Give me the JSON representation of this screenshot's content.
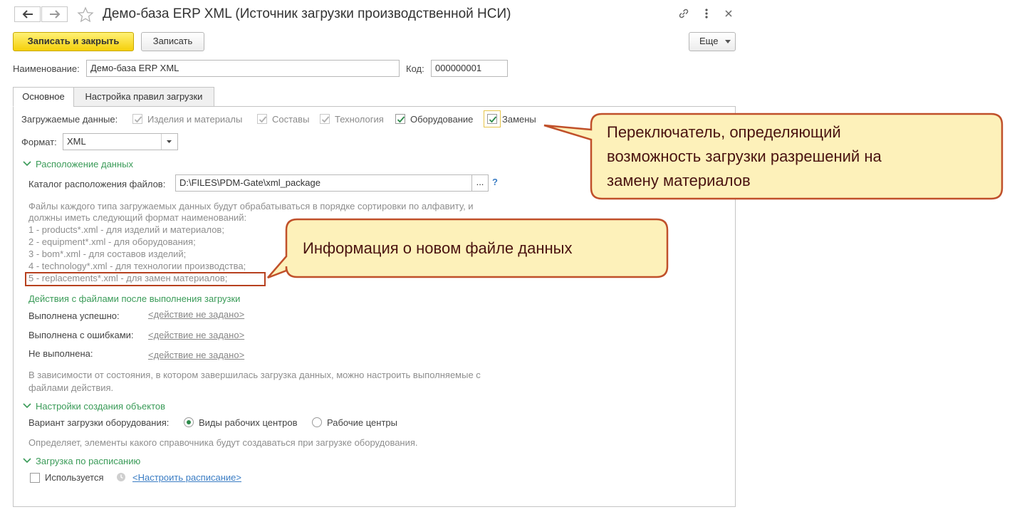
{
  "window": {
    "title": "Демо-база ERP XML (Источник загрузки производственной НСИ)"
  },
  "toolbar": {
    "save_close_label": "Записать и закрыть",
    "save_label": "Записать",
    "more_label": "Еще"
  },
  "form": {
    "name_label": "Наименование:",
    "name_value": "Демо-база ERP XML",
    "code_label": "Код:",
    "code_value": "000000001"
  },
  "tabs": [
    {
      "label": "Основное",
      "active": true
    },
    {
      "label": "Настройка правил загрузки",
      "active": false
    }
  ],
  "loaded_data": {
    "label": "Загружаемые данные:",
    "items": [
      {
        "label": "Изделия и материалы",
        "checked": true,
        "enabled": false
      },
      {
        "label": "Составы",
        "checked": true,
        "enabled": false
      },
      {
        "label": "Технология",
        "checked": true,
        "enabled": false
      },
      {
        "label": "Оборудование",
        "checked": true,
        "enabled": true
      },
      {
        "label": "Замены",
        "checked": true,
        "enabled": true
      }
    ]
  },
  "format": {
    "label": "Формат:",
    "value": "XML"
  },
  "data_location": {
    "section_title": "Расположение данных",
    "dir_label": "Каталог расположения файлов:",
    "dir_value": "D:\\FILES\\PDM-Gate\\xml_package",
    "browse_label": "...",
    "help_label": "?",
    "note_lines": [
      "Файлы каждого типа загружаемых данных будут обрабатываться в порядке сортировки по алфавиту, и",
      "должны иметь следующий формат наименований:",
      "1 - products*.xml - для изделий и материалов;",
      "2 - equipment*.xml - для оборудования;",
      "3 - bom*.xml - для составов изделий;",
      "4 - technology*.xml - для технологии производства;",
      "5 - replacements*.xml - для замен материалов;"
    ]
  },
  "file_actions": {
    "section_title": "Действия с файлами после выполнения загрузки",
    "rows": [
      {
        "label": "Выполнена успешно:",
        "link": "<действие не задано>"
      },
      {
        "label": "Выполнена с ошибками:",
        "link": "<действие не задано>"
      },
      {
        "label": "Не выполнена:",
        "link": "<действие не задано>"
      }
    ],
    "note_lines": [
      "В зависимости от состояния, в котором завершилась загрузка данных, можно настроить выполняемые с",
      "файлами действия."
    ]
  },
  "object_creation": {
    "section_title": "Настройки создания объектов",
    "variant_label": "Вариант загрузки оборудования:",
    "options": [
      {
        "label": "Виды рабочих центров",
        "selected": true
      },
      {
        "label": "Рабочие центры",
        "selected": false
      }
    ],
    "note": "Определяет, элементы какого справочника будут создаваться при загрузке оборудования."
  },
  "schedule": {
    "section_title": "Загрузка по расписанию",
    "used_label": "Используется",
    "used_checked": false,
    "schedule_link": "<Настроить расписание>"
  },
  "callouts": {
    "switch_lines": [
      "Переключатель, определяющий",
      "возможность загрузки разрешений на",
      "замену материалов"
    ],
    "info_text": "Информация о новом файле данных"
  },
  "colors": {
    "accent_green": "#3a9b58",
    "primary_button": "#f5d00a",
    "callout_fill": "#fdf1ba",
    "callout_border": "#c0502a",
    "highlight_box": "#b7411f"
  }
}
